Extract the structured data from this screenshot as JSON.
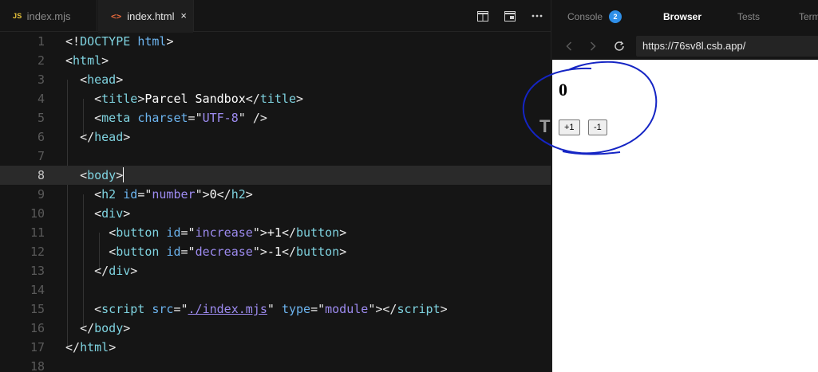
{
  "tabs": {
    "tab1": {
      "badge": "JS",
      "label": "index.mjs"
    },
    "tab2": {
      "badge": "<>",
      "label": "index.html",
      "close": "×"
    }
  },
  "editor": {
    "active_line": 8,
    "line_numbers": [
      "1",
      "2",
      "3",
      "4",
      "5",
      "6",
      "7",
      "8",
      "9",
      "10",
      "11",
      "12",
      "13",
      "14",
      "15",
      "16",
      "17",
      "18"
    ]
  },
  "panel": {
    "tabs": {
      "console": "Console",
      "console_badge": "2",
      "browser": "Browser",
      "tests": "Tests",
      "terminal": "Term"
    },
    "url": "https://76sv8l.csb.app/"
  },
  "preview": {
    "number": "0",
    "increase_label": "+1",
    "decrease_label": "-1"
  },
  "annotation": {
    "color": "#1525c4"
  }
}
